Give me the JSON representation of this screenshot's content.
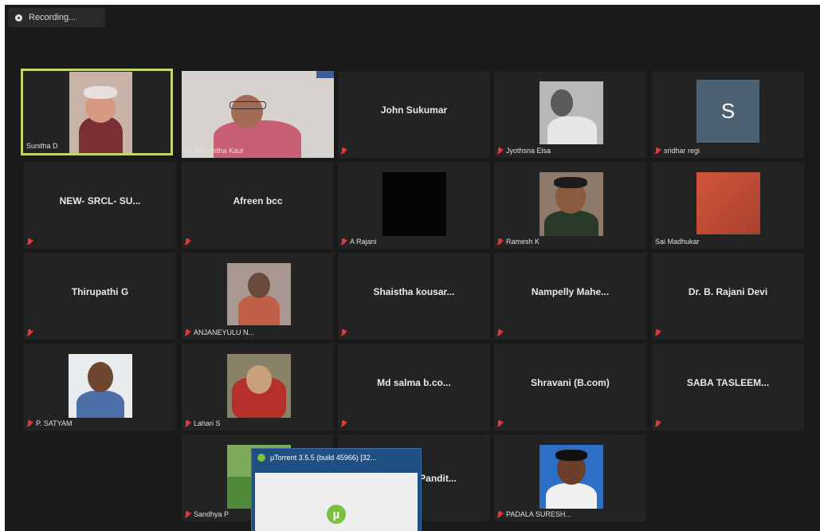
{
  "recording": {
    "label": "Recording..."
  },
  "tiles": [
    {
      "name": "Sunitha D",
      "photo": true
    },
    {
      "name": "Dr Harichitha Kaur",
      "photo": true
    },
    {
      "name": "John Sukumar",
      "center": "John Sukumar"
    },
    {
      "name": "Jyothsna Elsa",
      "photo": true
    },
    {
      "name": "sridhar regi",
      "avatar_letter": "S"
    },
    {
      "name": "NEW- SRCL- SU...",
      "center": "NEW- SRCL- SU..."
    },
    {
      "name": "Afreen bcc",
      "center": "Afreen bcc"
    },
    {
      "name": "A Rajani",
      "photo": true
    },
    {
      "name": "Ramesh K",
      "photo": true
    },
    {
      "name": "Sai Madhukar",
      "photo": true
    },
    {
      "name": "Thirupathi G",
      "center": "Thirupathi G"
    },
    {
      "name": "ANJANEYULU N...",
      "photo": true
    },
    {
      "name": "Shaistha kousar...",
      "center": "Shaistha kousar..."
    },
    {
      "name": "Nampelly Mahe...",
      "center": "Nampelly Mahe..."
    },
    {
      "name": "Dr. B. Rajani Devi",
      "center": "Dr. B. Rajani Devi"
    },
    {
      "name": "P. SATYAM",
      "photo": true
    },
    {
      "name": "Lahari S",
      "photo": true
    },
    {
      "name": "Md salma b.co...",
      "center": "Md salma b.co..."
    },
    {
      "name": "Shravani (B.com)",
      "center": "Shravani (B.com)"
    },
    {
      "name": "SABA TASLEEM...",
      "center": "SABA TASLEEM..."
    },
    {
      "name": "Sandhya P",
      "photo": true
    },
    {
      "name": "Pandit...",
      "center": "Pandit..."
    },
    {
      "name": "PADALA SURESH...",
      "photo": true
    }
  ],
  "utorrent": {
    "title": "µTorrent 3.5.5 (build 45966) [32..."
  },
  "colors": {
    "speaker_border": "#bfd66b",
    "muted_mic": "#e03a3a",
    "background": "#1a1a1a"
  }
}
